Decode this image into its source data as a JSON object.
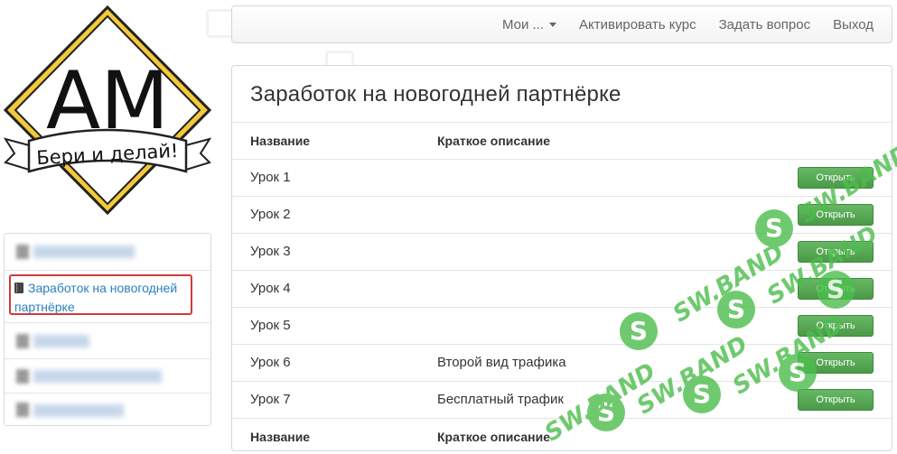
{
  "logo": {
    "letters": "AM",
    "slogan": "Бери и делай!"
  },
  "navbar": {
    "items": [
      {
        "label": "Мои ...",
        "has_caret": true
      },
      {
        "label": "Активировать курс"
      },
      {
        "label": "Задать вопрос"
      },
      {
        "label": "Выход"
      }
    ]
  },
  "sidebar": {
    "active_item": "Заработок на новогодней партнёрке"
  },
  "main": {
    "title": "Заработок на новогодней партнёрке",
    "columns": {
      "name": "Название",
      "description": "Краткое описание"
    },
    "button_label": "Открыть",
    "rows": [
      {
        "name": "Урок 1",
        "description": ""
      },
      {
        "name": "Урок 2",
        "description": ""
      },
      {
        "name": "Урок 3",
        "description": ""
      },
      {
        "name": "Урок 4",
        "description": ""
      },
      {
        "name": "Урок 5",
        "description": ""
      },
      {
        "name": "Урок 6",
        "description": "Второй вид трафика"
      },
      {
        "name": "Урок 7",
        "description": "Бесплатный трафик"
      }
    ]
  },
  "watermark": {
    "text": "SW.BAND",
    "color": "#4cbe4c"
  },
  "colors": {
    "button_green": "#5cb85c",
    "link_blue": "#2a7fbf",
    "highlight_red": "#d03a3a"
  }
}
